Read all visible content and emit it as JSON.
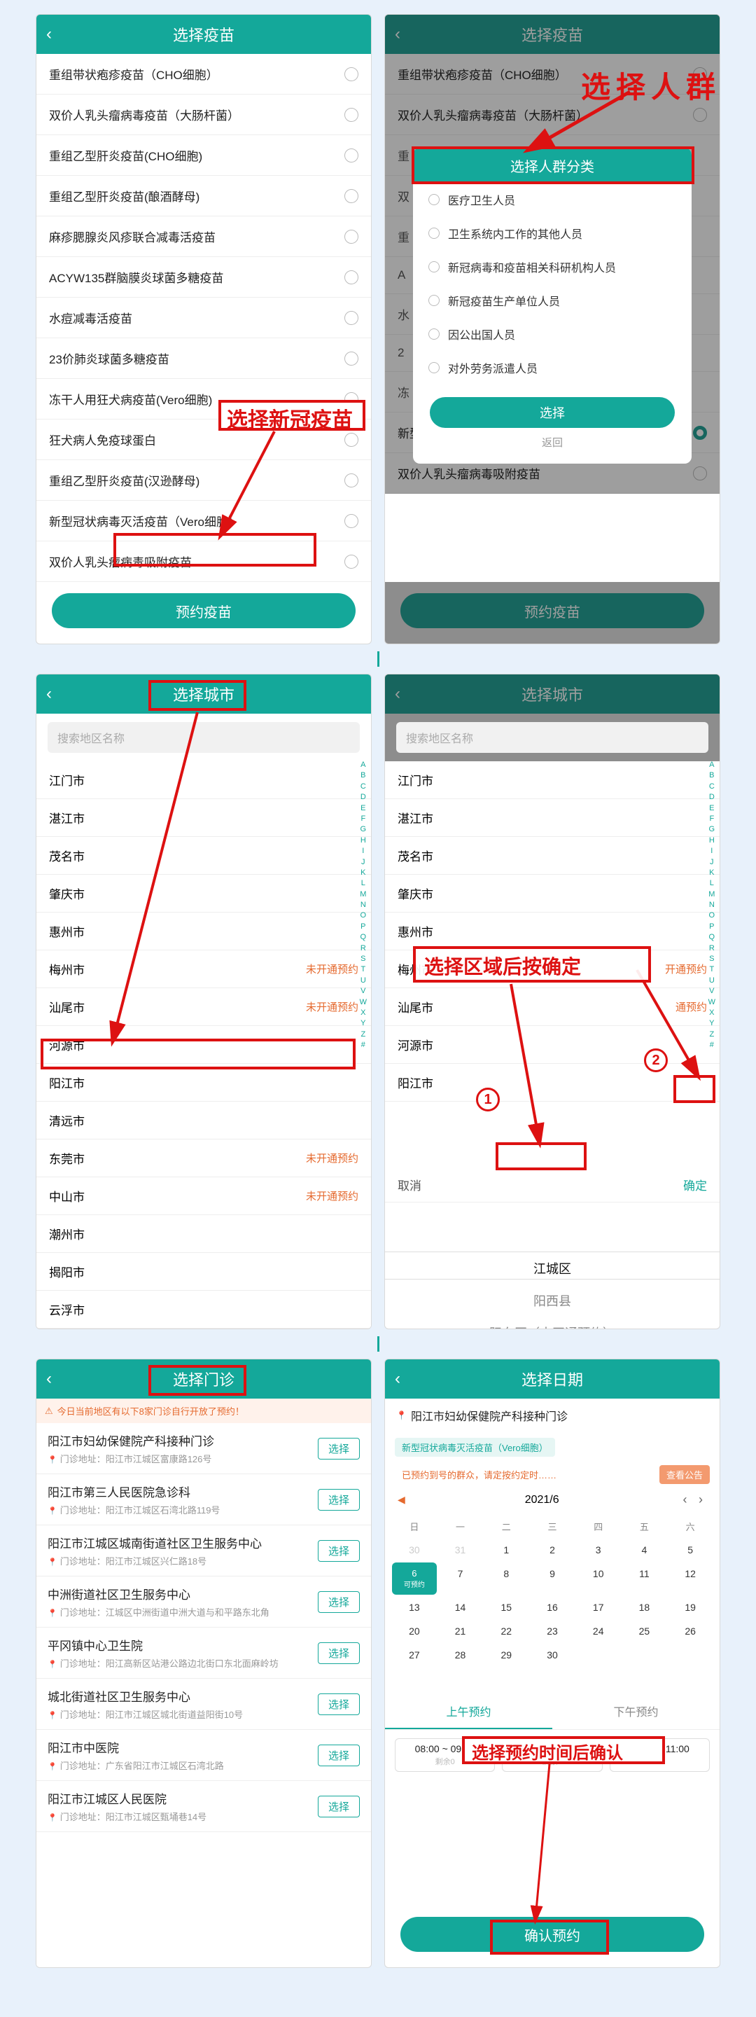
{
  "colors": {
    "primary": "#14a89a",
    "accent_red": "#d11",
    "warn": "#e56a2f"
  },
  "annotations": {
    "sel_vaccine": "选择新冠疫苗",
    "sel_group": "选择人群",
    "sel_city": "选择城市",
    "sel_region_confirm": "选择区域后按确定",
    "sel_clinic": "选择门诊",
    "sel_time_confirm": "选择预约时间后确认"
  },
  "panel1": {
    "title": "选择疫苗",
    "items": [
      "重组带状疱疹疫苗（CHO细胞）",
      "双价人乳头瘤病毒疫苗（大肠杆菌）",
      "重组乙型肝炎疫苗(CHO细胞)",
      "重组乙型肝炎疫苗(酿酒酵母)",
      "麻疹腮腺炎风疹联合减毒活疫苗",
      "ACYW135群脑膜炎球菌多糖疫苗",
      "水痘减毒活疫苗",
      "23价肺炎球菌多糖疫苗",
      "冻干人用狂犬病疫苗(Vero细胞)",
      "狂犬病人免疫球蛋白",
      "重组乙型肝炎疫苗(汉逊酵母)",
      "新型冠状病毒灭活疫苗（Vero细胞）",
      "双价人乳头瘤病毒吸附疫苗"
    ],
    "button": "预约疫苗"
  },
  "panel2": {
    "title": "选择疫苗",
    "bg_items": [
      "重组带状疱疹疫苗（CHO细胞）",
      "双价人乳头瘤病毒疫苗（大肠杆菌）"
    ],
    "modal_title": "选择人群分类",
    "modal_items": [
      "医疗卫生人员",
      "卫生系统内工作的其他人员",
      "新冠病毒和疫苗相关科研机构人员",
      "新冠疫苗生产单位人员",
      "因公出国人员",
      "对外劳务派遣人员"
    ],
    "modal_btn": "选择",
    "modal_back": "返回",
    "bg_items_tail": [
      "新型冠状病毒灭活疫苗（Vero细胞）",
      "双价人乳头瘤病毒吸附疫苗"
    ],
    "button": "预约疫苗",
    "side_codes": [
      "重",
      "双",
      "重",
      "A",
      "水",
      "2",
      "冻"
    ]
  },
  "panel3": {
    "title": "选择城市",
    "search_ph": "搜索地区名称",
    "cities": [
      {
        "n": "江门市",
        "s": ""
      },
      {
        "n": "湛江市",
        "s": ""
      },
      {
        "n": "茂名市",
        "s": ""
      },
      {
        "n": "肇庆市",
        "s": ""
      },
      {
        "n": "惠州市",
        "s": ""
      },
      {
        "n": "梅州市",
        "s": "未开通预约"
      },
      {
        "n": "汕尾市",
        "s": "未开通预约"
      },
      {
        "n": "河源市",
        "s": ""
      },
      {
        "n": "阳江市",
        "s": ""
      },
      {
        "n": "清远市",
        "s": ""
      },
      {
        "n": "东莞市",
        "s": "未开通预约"
      },
      {
        "n": "中山市",
        "s": "未开通预约"
      },
      {
        "n": "潮州市",
        "s": ""
      },
      {
        "n": "揭阳市",
        "s": ""
      },
      {
        "n": "云浮市",
        "s": ""
      }
    ],
    "alpha": [
      "A",
      "B",
      "C",
      "D",
      "E",
      "F",
      "G",
      "H",
      "I",
      "J",
      "K",
      "L",
      "M",
      "N",
      "O",
      "P",
      "Q",
      "R",
      "S",
      "T",
      "U",
      "V",
      "W",
      "X",
      "Y",
      "Z",
      "#"
    ]
  },
  "panel4": {
    "title": "选择城市",
    "search_ph": "搜索地区名称",
    "cities": [
      {
        "n": "江门市",
        "s": ""
      },
      {
        "n": "湛江市",
        "s": ""
      },
      {
        "n": "茂名市",
        "s": ""
      },
      {
        "n": "肇庆市",
        "s": ""
      },
      {
        "n": "惠州市",
        "s": ""
      },
      {
        "n": "梅州市",
        "s": "开通预约"
      },
      {
        "n": "汕尾市",
        "s": "通预约"
      },
      {
        "n": "河源市",
        "s": ""
      },
      {
        "n": "阳江市",
        "s": ""
      }
    ],
    "picker": {
      "cancel": "取消",
      "ok": "确定",
      "options": [
        "江城区",
        "阳西县",
        "阳东区（未开通预约）"
      ]
    }
  },
  "panel5": {
    "title": "选择门诊",
    "notice": "今日当前地区有以下8家门诊自行开放了预约！",
    "clinics": [
      {
        "t": "阳江市妇幼保健院产科接种门诊",
        "a": "门诊地址：阳江市江城区富康路126号"
      },
      {
        "t": "阳江市第三人民医院急诊科",
        "a": "门诊地址：阳江市江城区石湾北路119号"
      },
      {
        "t": "阳江市江城区城南街道社区卫生服务中心",
        "a": "门诊地址：阳江市江城区兴仁路18号"
      },
      {
        "t": "中洲街道社区卫生服务中心",
        "a": "门诊地址：江城区中洲街道中洲大道与和平路东北角"
      },
      {
        "t": "平冈镇中心卫生院",
        "a": "门诊地址：阳江高新区站港公路边北街口东北面麻岭坊"
      },
      {
        "t": "城北街道社区卫生服务中心",
        "a": "门诊地址：阳江市江城区城北街道益阳街10号"
      },
      {
        "t": "阳江市中医院",
        "a": "门诊地址：广东省阳江市江城区石湾北路"
      },
      {
        "t": "阳江市江城区人民医院",
        "a": "门诊地址：阳江市江城区甄埇巷14号"
      }
    ],
    "select": "选择"
  },
  "panel6": {
    "title": "选择日期",
    "clinic_name": "阳江市妇幼保健院产科接种门诊",
    "chip_tag": "新型冠状病毒灭活疫苗（Vero细胞）",
    "chip_warn": "已预约到号的群众，请定按约定时……",
    "chip_act": "查看公告",
    "month": "2021/6",
    "weekdays": [
      "日",
      "一",
      "二",
      "三",
      "四",
      "五",
      "六"
    ],
    "prev_tail": [
      30,
      31
    ],
    "days": [
      1,
      2,
      3,
      4,
      5,
      6,
      7,
      8,
      9,
      10,
      11,
      12,
      13,
      14,
      15,
      16,
      17,
      18,
      19,
      20,
      21,
      22,
      23,
      24,
      25,
      26,
      27,
      28,
      29,
      30
    ],
    "cur_day": 6,
    "cur_lbl": "可预约",
    "tab_am": "上午预约",
    "tab_pm": "下午预约",
    "slots": [
      {
        "t": "08:00 ~ 09:00",
        "s": "剩余0"
      },
      {
        "t": "09:00 ~ 10:00",
        "s": "剩余0"
      },
      {
        "t": "10:00 ~ 11:00",
        "s": ""
      }
    ],
    "confirm": "确认预约"
  }
}
